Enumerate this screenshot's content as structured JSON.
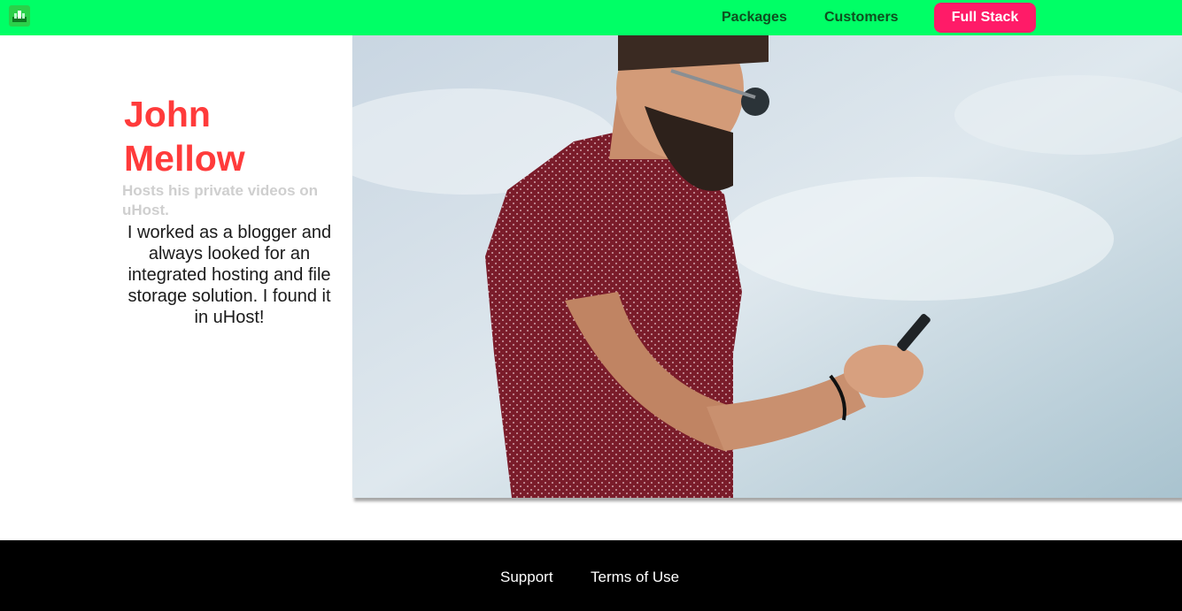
{
  "header": {
    "logo_icon": "uhost-logo-icon",
    "nav": {
      "packages": "Packages",
      "customers": "Customers",
      "cta": "Full Stack"
    },
    "colors": {
      "background": "#00ff66",
      "cta": "#ff1b68"
    }
  },
  "testimonial": {
    "name": "John Mellow",
    "tagline": "Hosts his private videos on uHost.",
    "quote": "I worked as a blogger and always looked for an integrated hosting and file storage solution. I found it in uHost!",
    "image": "man-with-phone-photo"
  },
  "footer": {
    "links": [
      "Support",
      "Terms of Use"
    ]
  }
}
